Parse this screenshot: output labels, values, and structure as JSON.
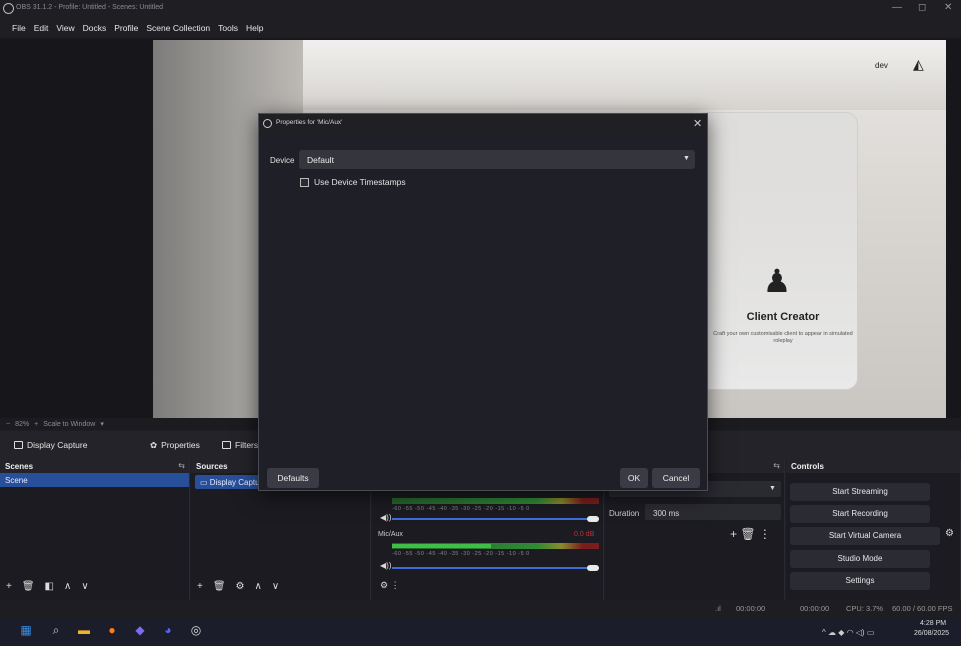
{
  "window": {
    "title": "OBS 31.1.2 - Profile: Untitled - Scenes: Untitled",
    "minimize_glyph": "—",
    "maximize_glyph": "◻",
    "close_glyph": "✕"
  },
  "menu": [
    "File",
    "Edit",
    "View",
    "Docks",
    "Profile",
    "Scene Collection",
    "Tools",
    "Help"
  ],
  "preview": {
    "card_title": "Client Creator",
    "card_desc": "Craft your own customisable client to appear in simulated roleplay",
    "dev_label": "dev",
    "zoom": "82%",
    "scale_mode": "Scale to Window",
    "minus": "−",
    "plus": "+"
  },
  "source_toolbar": {
    "source_name": "Display Capture",
    "properties": "Properties",
    "filters": "Filters"
  },
  "scenes": {
    "header": "Scenes",
    "items": [
      "Scene"
    ]
  },
  "sources": {
    "header": "Sources",
    "items": [
      "Display Capture"
    ]
  },
  "audio": {
    "channel2_name": "Mic/Aux",
    "channel2_db": "0.0 dB",
    "scale_labels": "-60 -55 -50 -45 -40 -35 -30 -25 -20 -15 -10 -5 0",
    "channel1_level": 0.0,
    "channel2_level": 0.48
  },
  "transitions": {
    "duration_label": "Duration",
    "duration_value": "300 ms"
  },
  "controls": {
    "header": "Controls",
    "buttons": [
      "Start Streaming",
      "Start Recording",
      "Start Virtual Camera",
      "Studio Mode",
      "Settings"
    ]
  },
  "statusbar": {
    "stream_time": "00:00:00",
    "rec_time": "00:00:00",
    "cpu": "CPU: 3.7%",
    "fps": "60.00 / 60.00 FPS"
  },
  "taskbar": {
    "time": "4:28 PM",
    "date": "26/08/2025"
  },
  "dialog": {
    "title": "Properties for 'Mic/Aux'",
    "device_label": "Device",
    "device_value": "Default",
    "timestamps_label": "Use Device Timestamps",
    "timestamps_checked": false,
    "defaults_button": "Defaults",
    "ok_button": "OK",
    "cancel_button": "Cancel"
  },
  "colors": {
    "accent": "#284f9a",
    "meter_green": "#3fbf48",
    "meter_red": "#7b1d1d"
  }
}
